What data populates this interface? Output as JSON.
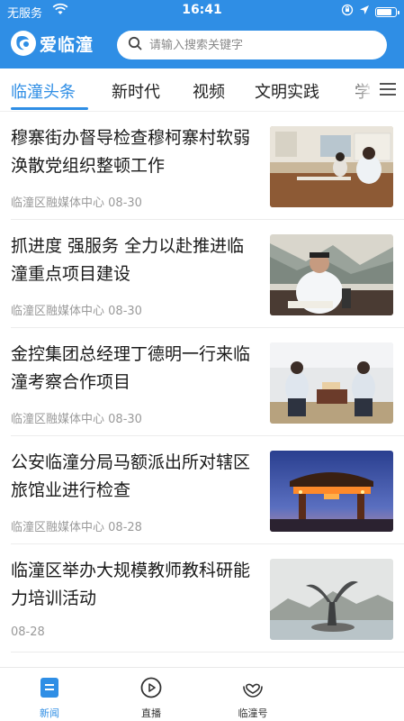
{
  "status_bar": {
    "carrier": "无服务",
    "time": "16:41",
    "battery_level": 0.85
  },
  "header": {
    "app_name": "爱临潼",
    "search_placeholder": "请输入搜索关键字",
    "search_icon": "search-icon"
  },
  "tabs": [
    {
      "label": "临潼头条",
      "active": true
    },
    {
      "label": "新时代",
      "active": false
    },
    {
      "label": "视频",
      "active": false
    },
    {
      "label": "文明实践",
      "active": false
    },
    {
      "label": "学",
      "active": false
    }
  ],
  "news": [
    {
      "title": "穆寨街办督导检查穆柯寨村软弱涣散党组织整顿工作",
      "source": "临潼区融媒体中心",
      "date": "08-30"
    },
    {
      "title": "抓进度 强服务 全力以赴推进临潼重点项目建设",
      "source": "临潼区融媒体中心",
      "date": "08-30"
    },
    {
      "title": "金控集团总经理丁德明一行来临潼考察合作项目",
      "source": "临潼区融媒体中心",
      "date": "08-30"
    },
    {
      "title": "公安临潼分局马额派出所对辖区旅馆业进行检查",
      "source": "临潼区融媒体中心",
      "date": "08-28"
    },
    {
      "title": "临潼区举办大规模教师教科研能力培训活动",
      "source": "",
      "date": "08-28"
    }
  ],
  "bottom_nav": [
    {
      "label": "新闻",
      "icon": "news-icon",
      "active": true
    },
    {
      "label": "直播",
      "icon": "play-icon",
      "active": false
    },
    {
      "label": "临潼号",
      "icon": "heart-hands-icon",
      "active": false
    }
  ],
  "colors": {
    "brand": "#2f8ee5",
    "text": "#1a1a1a",
    "meta": "#9a9a9a"
  }
}
